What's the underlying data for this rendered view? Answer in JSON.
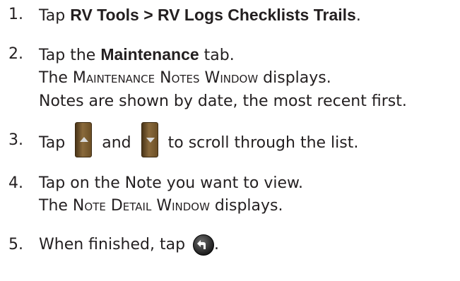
{
  "steps": [
    {
      "num": "1.",
      "pre": "Tap ",
      "bold": "RV Tools > RV Logs Checklists Trails",
      "post": "."
    },
    {
      "num": "2.",
      "pre": "Tap the ",
      "bold": "Maintenance",
      "post": " tab.",
      "line2": {
        "pre": "The ",
        "sc": [
          [
            "M",
            "AINTENANCE"
          ],
          [
            "N",
            "OTES"
          ],
          [
            "W",
            "INDOW"
          ]
        ],
        "post": " displays."
      },
      "line3": "Notes are shown by date, the most recent first."
    },
    {
      "num": "3.",
      "pre": "Tap",
      "mid": "and",
      "post": "to scroll through the list.",
      "icons": [
        "scroll-up-arrow-icon",
        "scroll-down-arrow-icon"
      ]
    },
    {
      "num": "4.",
      "text": "Tap on the Note you want to view.",
      "line2": {
        "pre": "The ",
        "sc": [
          [
            "N",
            "OTE"
          ],
          [
            "D",
            "ETAIL"
          ],
          [
            "W",
            "INDOW"
          ]
        ],
        "post": " displays."
      }
    },
    {
      "num": "5.",
      "pre": "When finished, tap ",
      "post": ".",
      "icon": "back-arrow-icon"
    }
  ]
}
